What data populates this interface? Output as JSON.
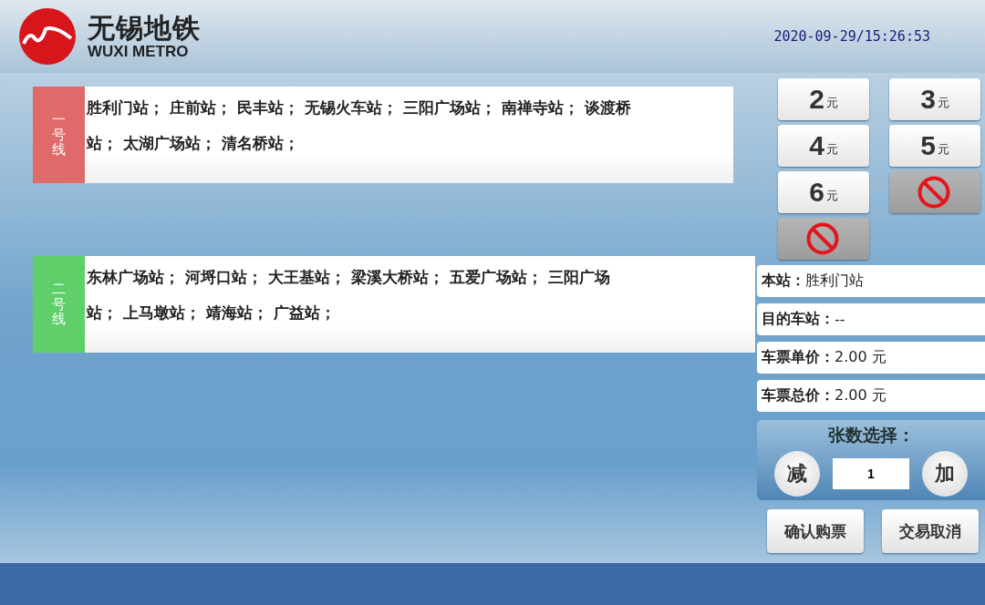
{
  "header": {
    "logo_cn": "无锡地铁",
    "logo_en": "WUXI METRO",
    "datetime": "2020-09-29/15:26:53"
  },
  "lines": [
    {
      "label": "一号线",
      "color": "#e06a6a",
      "rows": [
        "胜利门站； 庄前站； 民丰站； 无锡火车站； 三阳广场站； 南禅寺站； 谈渡桥",
        "站； 太湖广场站； 清名桥站；"
      ]
    },
    {
      "label": "二号线",
      "color": "#5fcf6a",
      "rows": [
        "东林广场站； 河埒口站； 大王基站； 梁溪大桥站； 五爱广场站； 三阳广场",
        "站； 上马墩站； 靖海站； 广益站；"
      ]
    }
  ],
  "fares": [
    {
      "amount": "2",
      "unit": "元",
      "disabled": false
    },
    {
      "amount": "3",
      "unit": "元",
      "disabled": false
    },
    {
      "amount": "4",
      "unit": "元",
      "disabled": false
    },
    {
      "amount": "5",
      "unit": "元",
      "disabled": false
    },
    {
      "amount": "6",
      "unit": "元",
      "disabled": false
    },
    {
      "disabled": true
    },
    {
      "disabled": true
    }
  ],
  "info": [
    "**本站：**胜利门站",
    "**目的车站：**--",
    "**车票单价：**2.00 元",
    "**车票总价：**2.00 元"
  ],
  "quantity": {
    "title": "张数选择：",
    "decrease": "减",
    "value": "1",
    "increase": "加"
  },
  "actions": [
    "确认购票",
    "交易取消"
  ]
}
